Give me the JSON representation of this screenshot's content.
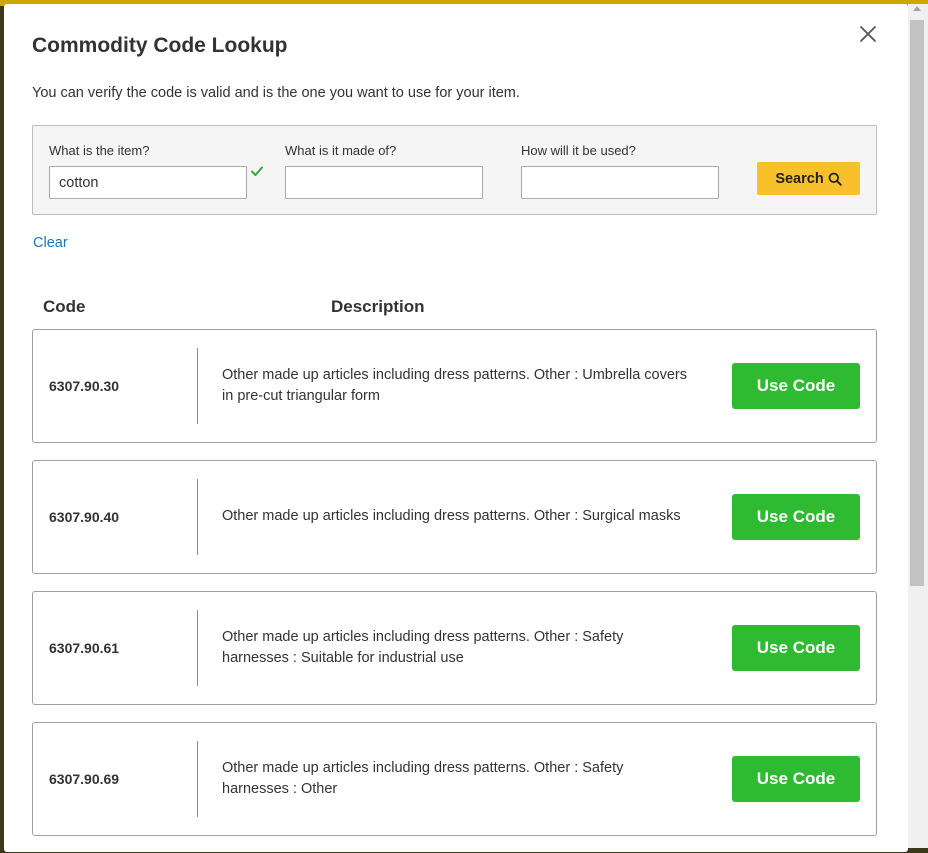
{
  "modal": {
    "title": "Commodity Code Lookup",
    "subtitle": "You can verify the code is valid and is the one you want to use for your item."
  },
  "search": {
    "item_label": "What is the item?",
    "item_value": "cotton",
    "material_label": "What is it made of?",
    "material_value": "",
    "usage_label": "How will it be used?",
    "usage_value": "",
    "button_label": "Search",
    "button_icon": "magnifier-icon"
  },
  "clear_label": "Clear",
  "table": {
    "code_header": "Code",
    "description_header": "Description"
  },
  "results": [
    {
      "code": "6307.90.30",
      "description": "Other made up articles including dress patterns. Other : Umbrella covers in pre-cut triangular form",
      "button": "Use Code"
    },
    {
      "code": "6307.90.40",
      "description": "Other made up articles including dress patterns. Other : Surgical masks",
      "button": "Use Code"
    },
    {
      "code": "6307.90.61",
      "description": "Other made up articles including dress patterns. Other : Safety harnesses : Suitable for industrial use",
      "button": "Use Code"
    },
    {
      "code": "6307.90.69",
      "description": "Other made up articles including dress patterns. Other : Safety harnesses : Other",
      "button": "Use Code"
    }
  ],
  "colors": {
    "search_button": "#f8c12b",
    "use_code_button": "#2ebb31",
    "link": "#1e74b8",
    "valid_check": "#2ea836"
  },
  "icons": {
    "close": "close-icon",
    "valid": "check-icon",
    "search": "magnifier-icon"
  }
}
